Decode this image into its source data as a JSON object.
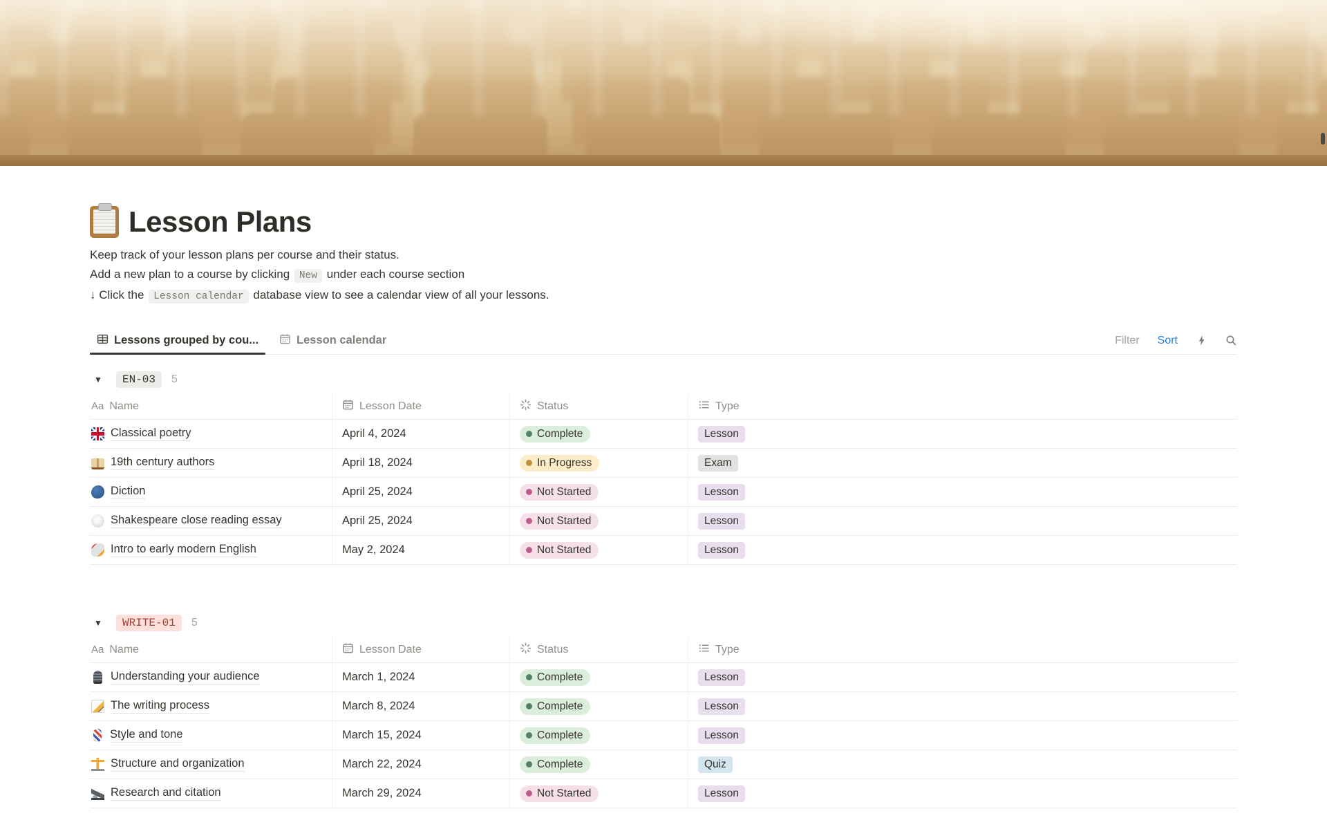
{
  "page": {
    "title": "Lesson Plans",
    "icon": "clipboard-icon"
  },
  "description": {
    "line1": "Keep track of your lesson plans per course and their status.",
    "line2_pre": "Add a new plan to a course by clicking",
    "line2_code": "New",
    "line2_post": "under each course section",
    "line3_pre": "↓ Click the",
    "line3_code": "Lesson calendar",
    "line3_post": "database view to see a calendar view of all your lessons."
  },
  "tabs": [
    {
      "label": "Lessons grouped by cou...",
      "icon": "table-icon",
      "active": true
    },
    {
      "label": "Lesson calendar",
      "icon": "calendar-icon",
      "active": false
    }
  ],
  "toolbar": {
    "filter_label": "Filter",
    "sort_label": "Sort",
    "sort_color": "#2383E2",
    "icons": [
      "lightning-icon",
      "search-icon"
    ]
  },
  "columns": [
    {
      "icon": "text-icon",
      "label": "Name"
    },
    {
      "icon": "calendar-icon",
      "label": "Lesson Date"
    },
    {
      "icon": "status-icon",
      "label": "Status"
    },
    {
      "icon": "list-icon",
      "label": "Type"
    }
  ],
  "status_styles": {
    "Complete": {
      "bg": "#DBEDDB",
      "dot": "#548164"
    },
    "In Progress": {
      "bg": "#FDECC8",
      "dot": "#C19138"
    },
    "Not Started": {
      "bg": "#F5E0E9",
      "dot": "#BE5B8D"
    }
  },
  "type_styles": {
    "Lesson": {
      "bg": "#E8DEEE"
    },
    "Exam": {
      "bg": "#E3E2E0"
    },
    "Quiz": {
      "bg": "#D3E5EF"
    }
  },
  "groups": [
    {
      "name": "EN-03",
      "count": "5",
      "tag_bg": "#EDECE9",
      "tag_color": "#32302C",
      "rows": [
        {
          "emoji": "flag-gb-emoji",
          "emoji_class": "e-flag-gb",
          "name": "Classical poetry",
          "date": "April 4, 2024",
          "status": "Complete",
          "type": "Lesson"
        },
        {
          "emoji": "open-book-emoji",
          "emoji_class": "e-open-book",
          "name": "19th century authors",
          "date": "April 18, 2024",
          "status": "In Progress",
          "type": "Exam"
        },
        {
          "emoji": "speaking-head-emoji",
          "emoji_class": "e-speaking-head",
          "name": "Diction",
          "date": "April 25, 2024",
          "status": "Not Started",
          "type": "Lesson"
        },
        {
          "emoji": "thought-balloon-emoji",
          "emoji_class": "e-thought-balloon",
          "name": "Shakespeare close reading essay",
          "date": "April 25, 2024",
          "status": "Not Started",
          "type": "Lesson"
        },
        {
          "emoji": "rocket-emoji",
          "emoji_class": "e-rocket",
          "name": "Intro to early modern English",
          "date": "May 2, 2024",
          "status": "Not Started",
          "type": "Lesson"
        }
      ]
    },
    {
      "name": "WRITE-01",
      "count": "5",
      "tag_bg": "#FBE0DB",
      "tag_color": "#9F3E36",
      "rows": [
        {
          "emoji": "microphone-emoji",
          "emoji_class": "e-microphone",
          "name": "Understanding your audience",
          "date": "March 1, 2024",
          "status": "Complete",
          "type": "Lesson"
        },
        {
          "emoji": "memo-emoji",
          "emoji_class": "e-memo",
          "name": "The writing process",
          "date": "March 8, 2024",
          "status": "Complete",
          "type": "Lesson"
        },
        {
          "emoji": "barber-pole-emoji",
          "emoji_class": "e-barber-pole",
          "name": "Style and tone",
          "date": "March 15, 2024",
          "status": "Complete",
          "type": "Lesson"
        },
        {
          "emoji": "crane-emoji",
          "emoji_class": "e-crane",
          "name": "Structure and organization",
          "date": "March 22, 2024",
          "status": "Complete",
          "type": "Quiz"
        },
        {
          "emoji": "microscope-emoji",
          "emoji_class": "e-microscope",
          "name": "Research and citation",
          "date": "March 29, 2024",
          "status": "Not Started",
          "type": "Lesson"
        }
      ]
    }
  ]
}
